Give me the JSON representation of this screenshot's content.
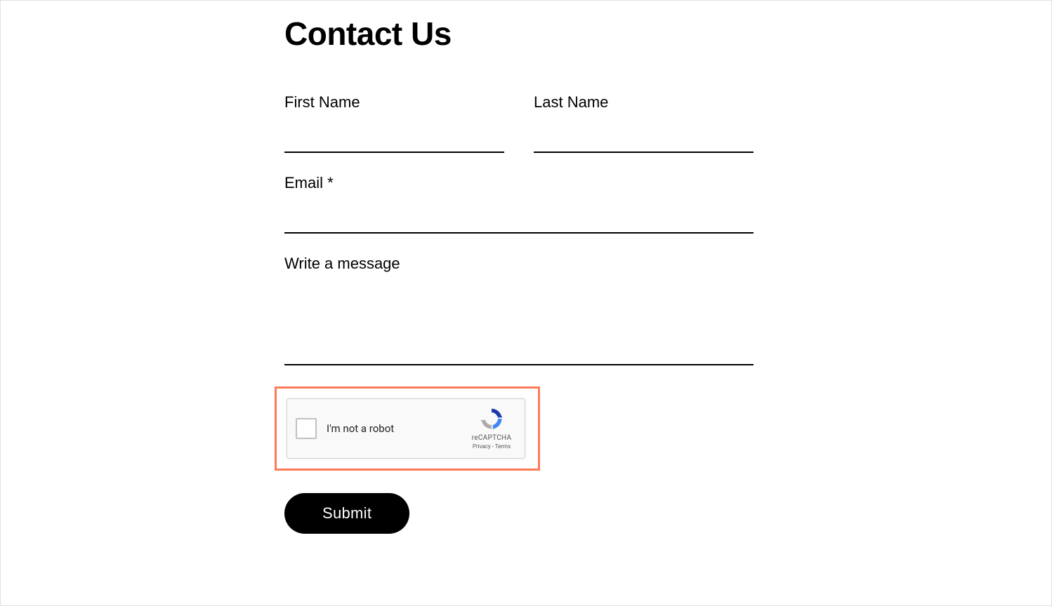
{
  "page": {
    "title": "Contact Us"
  },
  "form": {
    "firstName": {
      "label": "First Name",
      "value": ""
    },
    "lastName": {
      "label": "Last Name",
      "value": ""
    },
    "email": {
      "label": "Email *",
      "value": ""
    },
    "message": {
      "label": "Write a message",
      "value": ""
    },
    "submit": {
      "label": "Submit"
    }
  },
  "recaptcha": {
    "label": "I'm not a robot",
    "brand": "reCAPTCHA",
    "privacy": "Privacy",
    "separator": " - ",
    "terms": "Terms"
  }
}
